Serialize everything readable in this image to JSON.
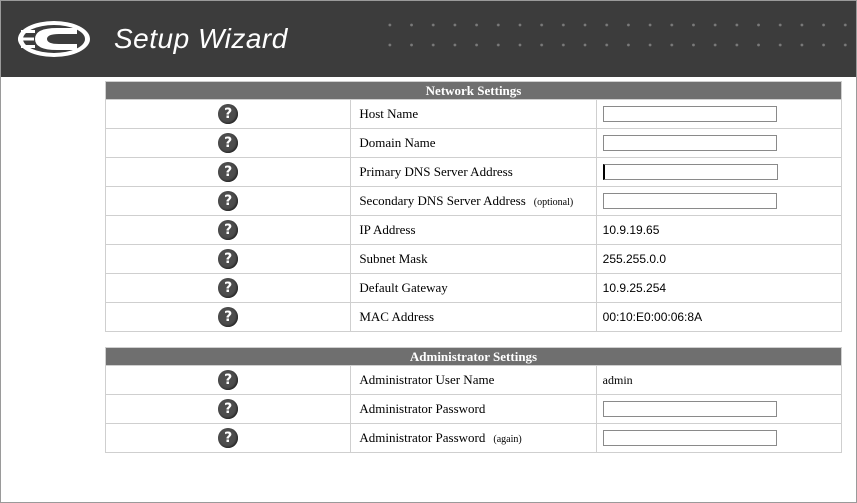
{
  "header": {
    "title": "Setup Wizard",
    "logo_icon": "c-logo-icon"
  },
  "network": {
    "heading": "Network Settings",
    "rows": [
      {
        "label": "Host Name",
        "type": "input",
        "value": ""
      },
      {
        "label": "Domain Name",
        "type": "input",
        "value": ""
      },
      {
        "label": "Primary DNS Server Address",
        "type": "input",
        "value": ""
      },
      {
        "label": "Secondary DNS Server Address",
        "note": "(optional)",
        "type": "input",
        "value": ""
      },
      {
        "label": "IP Address",
        "type": "text",
        "value": "10.9.19.65"
      },
      {
        "label": "Subnet Mask",
        "type": "text",
        "value": "255.255.0.0"
      },
      {
        "label": "Default Gateway",
        "type": "text",
        "value": "10.9.25.254"
      },
      {
        "label": "MAC Address",
        "type": "text",
        "value": "00:10:E0:00:06:8A"
      }
    ]
  },
  "admin": {
    "heading": "Administrator Settings",
    "rows": [
      {
        "label": "Administrator User Name",
        "type": "text",
        "value": "admin"
      },
      {
        "label": "Administrator Password",
        "type": "input",
        "value": ""
      },
      {
        "label": "Administrator Password",
        "note": "(again)",
        "type": "input",
        "value": ""
      }
    ]
  },
  "help_icon": "?",
  "colors": {
    "banner": "#3c3c3c",
    "section_header": "#6f6f6f",
    "help_icon": "#4d4d4d"
  }
}
